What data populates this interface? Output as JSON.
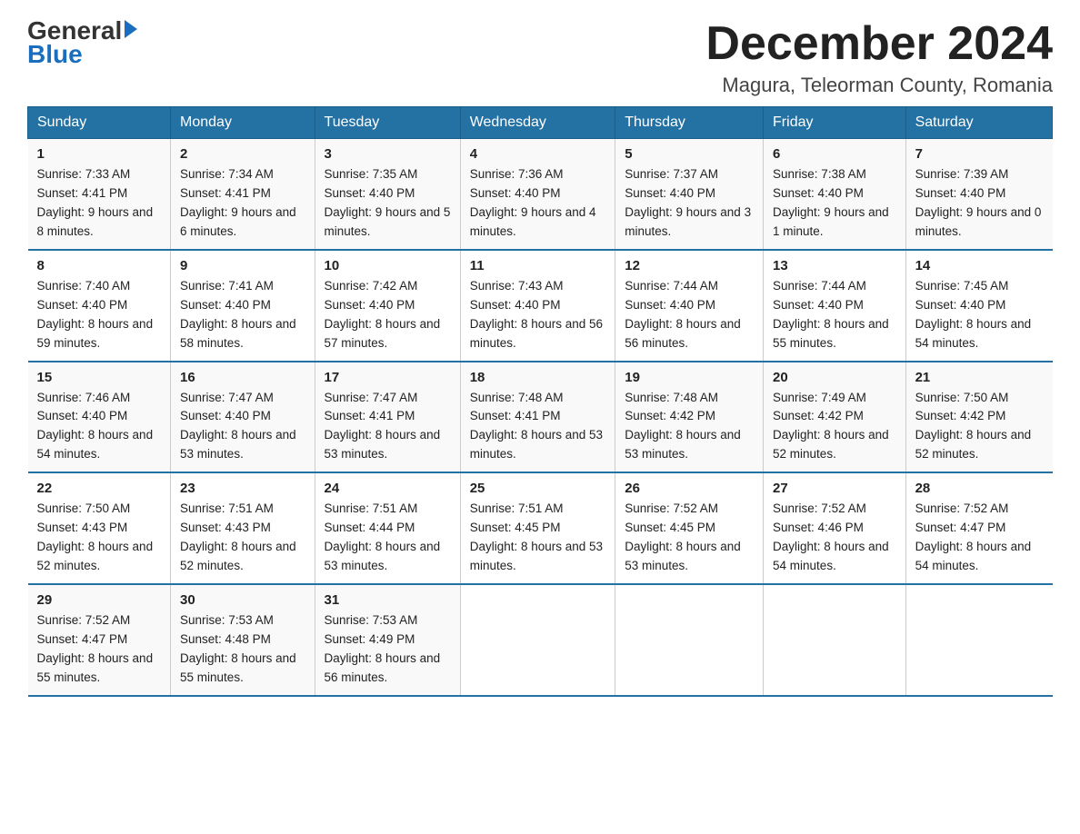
{
  "logo": {
    "general": "General",
    "blue": "Blue"
  },
  "title": "December 2024",
  "subtitle": "Magura, Teleorman County, Romania",
  "days_of_week": [
    "Sunday",
    "Monday",
    "Tuesday",
    "Wednesday",
    "Thursday",
    "Friday",
    "Saturday"
  ],
  "weeks": [
    [
      {
        "num": "1",
        "sunrise": "7:33 AM",
        "sunset": "4:41 PM",
        "daylight": "9 hours and 8 minutes."
      },
      {
        "num": "2",
        "sunrise": "7:34 AM",
        "sunset": "4:41 PM",
        "daylight": "9 hours and 6 minutes."
      },
      {
        "num": "3",
        "sunrise": "7:35 AM",
        "sunset": "4:40 PM",
        "daylight": "9 hours and 5 minutes."
      },
      {
        "num": "4",
        "sunrise": "7:36 AM",
        "sunset": "4:40 PM",
        "daylight": "9 hours and 4 minutes."
      },
      {
        "num": "5",
        "sunrise": "7:37 AM",
        "sunset": "4:40 PM",
        "daylight": "9 hours and 3 minutes."
      },
      {
        "num": "6",
        "sunrise": "7:38 AM",
        "sunset": "4:40 PM",
        "daylight": "9 hours and 1 minute."
      },
      {
        "num": "7",
        "sunrise": "7:39 AM",
        "sunset": "4:40 PM",
        "daylight": "9 hours and 0 minutes."
      }
    ],
    [
      {
        "num": "8",
        "sunrise": "7:40 AM",
        "sunset": "4:40 PM",
        "daylight": "8 hours and 59 minutes."
      },
      {
        "num": "9",
        "sunrise": "7:41 AM",
        "sunset": "4:40 PM",
        "daylight": "8 hours and 58 minutes."
      },
      {
        "num": "10",
        "sunrise": "7:42 AM",
        "sunset": "4:40 PM",
        "daylight": "8 hours and 57 minutes."
      },
      {
        "num": "11",
        "sunrise": "7:43 AM",
        "sunset": "4:40 PM",
        "daylight": "8 hours and 56 minutes."
      },
      {
        "num": "12",
        "sunrise": "7:44 AM",
        "sunset": "4:40 PM",
        "daylight": "8 hours and 56 minutes."
      },
      {
        "num": "13",
        "sunrise": "7:44 AM",
        "sunset": "4:40 PM",
        "daylight": "8 hours and 55 minutes."
      },
      {
        "num": "14",
        "sunrise": "7:45 AM",
        "sunset": "4:40 PM",
        "daylight": "8 hours and 54 minutes."
      }
    ],
    [
      {
        "num": "15",
        "sunrise": "7:46 AM",
        "sunset": "4:40 PM",
        "daylight": "8 hours and 54 minutes."
      },
      {
        "num": "16",
        "sunrise": "7:47 AM",
        "sunset": "4:40 PM",
        "daylight": "8 hours and 53 minutes."
      },
      {
        "num": "17",
        "sunrise": "7:47 AM",
        "sunset": "4:41 PM",
        "daylight": "8 hours and 53 minutes."
      },
      {
        "num": "18",
        "sunrise": "7:48 AM",
        "sunset": "4:41 PM",
        "daylight": "8 hours and 53 minutes."
      },
      {
        "num": "19",
        "sunrise": "7:48 AM",
        "sunset": "4:42 PM",
        "daylight": "8 hours and 53 minutes."
      },
      {
        "num": "20",
        "sunrise": "7:49 AM",
        "sunset": "4:42 PM",
        "daylight": "8 hours and 52 minutes."
      },
      {
        "num": "21",
        "sunrise": "7:50 AM",
        "sunset": "4:42 PM",
        "daylight": "8 hours and 52 minutes."
      }
    ],
    [
      {
        "num": "22",
        "sunrise": "7:50 AM",
        "sunset": "4:43 PM",
        "daylight": "8 hours and 52 minutes."
      },
      {
        "num": "23",
        "sunrise": "7:51 AM",
        "sunset": "4:43 PM",
        "daylight": "8 hours and 52 minutes."
      },
      {
        "num": "24",
        "sunrise": "7:51 AM",
        "sunset": "4:44 PM",
        "daylight": "8 hours and 53 minutes."
      },
      {
        "num": "25",
        "sunrise": "7:51 AM",
        "sunset": "4:45 PM",
        "daylight": "8 hours and 53 minutes."
      },
      {
        "num": "26",
        "sunrise": "7:52 AM",
        "sunset": "4:45 PM",
        "daylight": "8 hours and 53 minutes."
      },
      {
        "num": "27",
        "sunrise": "7:52 AM",
        "sunset": "4:46 PM",
        "daylight": "8 hours and 54 minutes."
      },
      {
        "num": "28",
        "sunrise": "7:52 AM",
        "sunset": "4:47 PM",
        "daylight": "8 hours and 54 minutes."
      }
    ],
    [
      {
        "num": "29",
        "sunrise": "7:52 AM",
        "sunset": "4:47 PM",
        "daylight": "8 hours and 55 minutes."
      },
      {
        "num": "30",
        "sunrise": "7:53 AM",
        "sunset": "4:48 PM",
        "daylight": "8 hours and 55 minutes."
      },
      {
        "num": "31",
        "sunrise": "7:53 AM",
        "sunset": "4:49 PM",
        "daylight": "8 hours and 56 minutes."
      },
      null,
      null,
      null,
      null
    ]
  ],
  "labels": {
    "sunrise": "Sunrise:",
    "sunset": "Sunset:",
    "daylight": "Daylight:"
  }
}
